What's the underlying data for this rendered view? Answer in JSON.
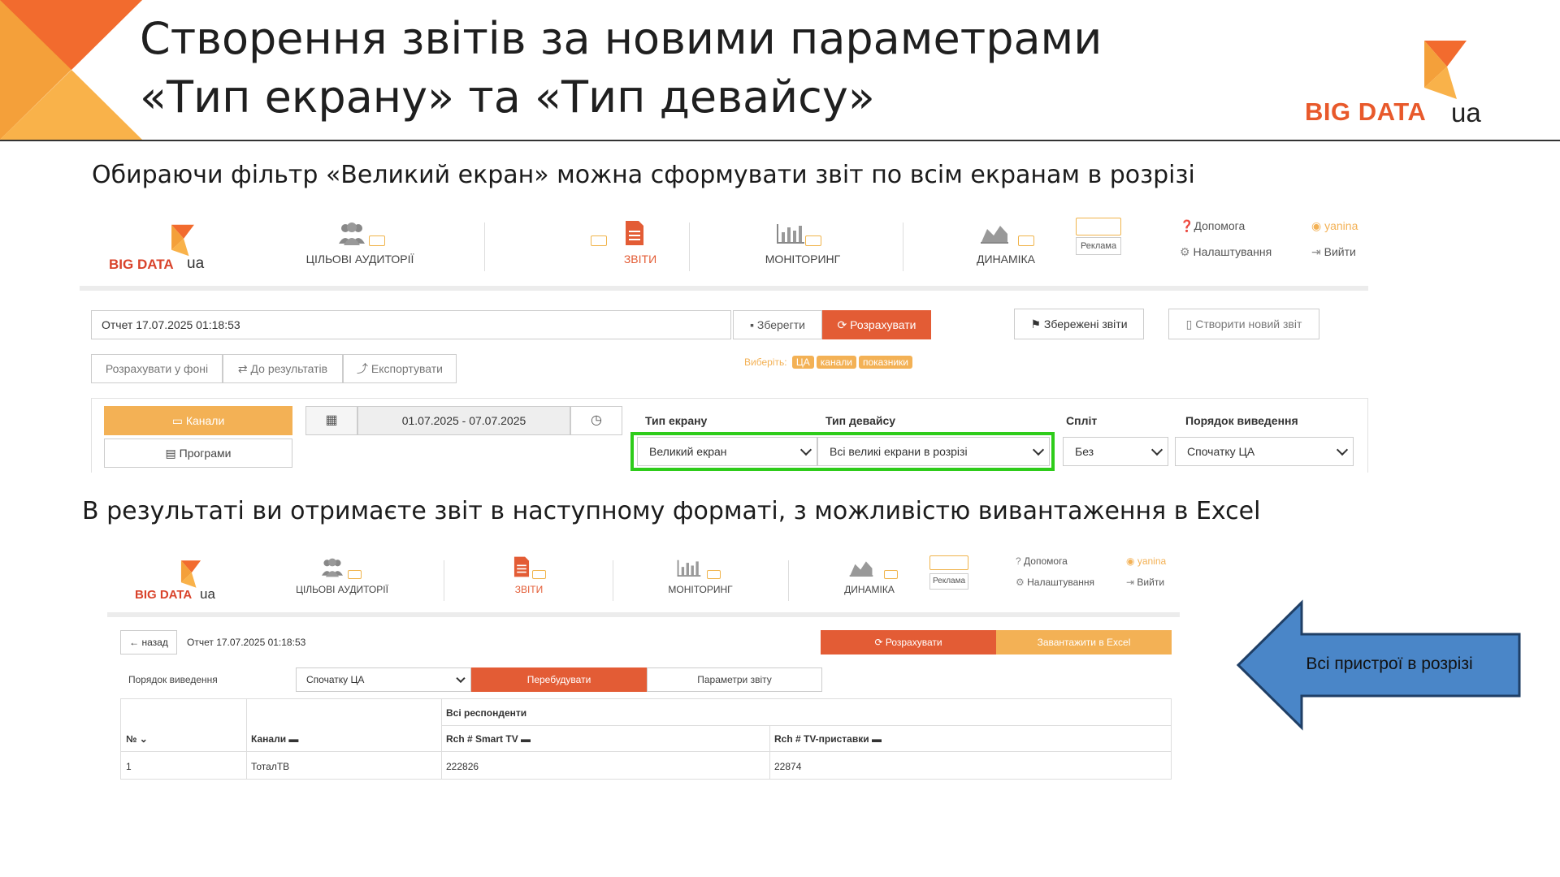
{
  "slide": {
    "title_line1": "Створення звітів за новими параметрами",
    "title_line2": "«Тип екрану» та «Тип девайсу»",
    "logo_big": "BIG DATA",
    "logo_ua": "ua",
    "caption_top": "Обираючи фільтр «Великий екран» можна сформувати звіт по всім екранам в розрізі",
    "caption_mid": "В результаті ви отримаєте звіт в наступному форматі, з можливістю вивантаження в Excel",
    "callout": "Всі пристрої в розрізі",
    "colors": {
      "accent_orange": "#e8592b",
      "accent_yellow": "#f3b155",
      "highlight_green": "#2ecc1a",
      "callout_blue": "#4a86c8"
    }
  },
  "app1": {
    "logo_big": "BIG DATA",
    "logo_ua": "ua",
    "nav": {
      "audiences": "ЦІЛЬОВІ АУДИТОРІЇ",
      "reports": "ЗВІТИ",
      "monitoring": "МОНІТОРИНГ",
      "dynamics": "ДИНАМІКА",
      "ads": "Реклама",
      "help": "Допомога",
      "settings": "Налаштування",
      "user": "yanina",
      "logout": "Вийти"
    },
    "report_name": "Отчет 17.07.2025 01:18:53",
    "save": "Зберегти",
    "calculate": "Розрахувати",
    "saved_reports": "Збережені звіти",
    "new_report": "Створити новий звіт",
    "calc_background": "Розрахувати у фоні",
    "to_results": "До результатів",
    "export": "Експортувати",
    "choose_label": "Виберіть:",
    "choose_chips": [
      "ЦА",
      "канали",
      "показники"
    ],
    "channels_tab": "Канали",
    "programs_tab": "Програми",
    "date_range": "01.07.2025 - 07.07.2025",
    "screen_type_label": "Тип екрану",
    "screen_type_value": "Великий екран",
    "device_type_label": "Тип девайсу",
    "device_type_value": "Всі великі екрани в розрізі",
    "split_label": "Спліт",
    "split_value": "Без",
    "order_label": "Порядок виведення",
    "order_value": "Спочатку ЦА"
  },
  "app2": {
    "logo_big": "BIG DATA",
    "logo_ua": "ua",
    "nav": {
      "audiences": "ЦІЛЬОВІ АУДИТОРІЇ",
      "reports": "ЗВІТИ",
      "monitoring": "МОНІТОРИНГ",
      "dynamics": "ДИНАМІКА",
      "ads": "Реклама",
      "help": "Допомога",
      "settings": "Налаштування",
      "user": "yanina",
      "logout": "Вийти"
    },
    "back": "назад",
    "report_name": "Отчет 17.07.2025 01:18:53",
    "calculate": "Розрахувати",
    "download_excel": "Завантажити в Excel",
    "order_label": "Порядок виведення",
    "order_value": "Спочатку ЦА",
    "rebuild": "Перебудувати",
    "report_params": "Параметри звіту",
    "table": {
      "group_header": "Всі респонденти",
      "columns": [
        "№",
        "Канали",
        "Rch # Smart TV",
        "Rch # TV-приставки"
      ],
      "rows": [
        [
          "1",
          "ТоталТВ",
          "222826",
          "22874"
        ]
      ]
    }
  }
}
